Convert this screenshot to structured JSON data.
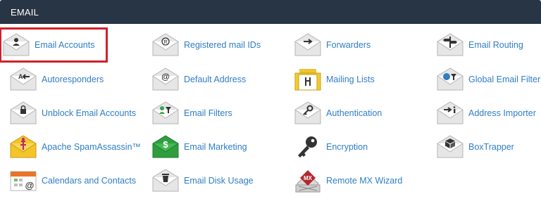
{
  "section": {
    "title": "EMAIL"
  },
  "colors": {
    "header_bg": "#283544",
    "link": "#2f7ec4",
    "highlight": "#d1202a"
  },
  "items": [
    {
      "label": "Email Accounts",
      "icon": "user-envelope-icon"
    },
    {
      "label": "Registered mail IDs",
      "icon": "registered-envelope-icon"
    },
    {
      "label": "Forwarders",
      "icon": "arrow-envelope-icon"
    },
    {
      "label": "Email Routing",
      "icon": "signpost-envelope-icon"
    },
    {
      "label": "Autoresponders",
      "icon": "autoreply-envelope-icon"
    },
    {
      "label": "Default Address",
      "icon": "at-envelope-icon"
    },
    {
      "label": "Mailing Lists",
      "icon": "mailing-list-envelope-icon"
    },
    {
      "label": "Global Email Filters",
      "icon": "global-filter-envelope-icon"
    },
    {
      "label": "Unblock Email Accounts",
      "icon": "lock-envelope-icon"
    },
    {
      "label": "Email Filters",
      "icon": "filter-envelope-icon"
    },
    {
      "label": "Authentication",
      "icon": "key-envelope-icon"
    },
    {
      "label": "Address Importer",
      "icon": "import-envelope-icon"
    },
    {
      "label": "Apache SpamAssassin™",
      "icon": "spamassassin-envelope-icon"
    },
    {
      "label": "Email Marketing",
      "icon": "dollar-envelope-icon"
    },
    {
      "label": "Encryption",
      "icon": "key-icon"
    },
    {
      "label": "BoxTrapper",
      "icon": "box-envelope-icon"
    },
    {
      "label": "Calendars and Contacts",
      "icon": "calendar-icon"
    },
    {
      "label": "Email Disk Usage",
      "icon": "trash-envelope-icon"
    },
    {
      "label": "Remote MX Wizard",
      "icon": "mx-wizard-icon"
    }
  ]
}
